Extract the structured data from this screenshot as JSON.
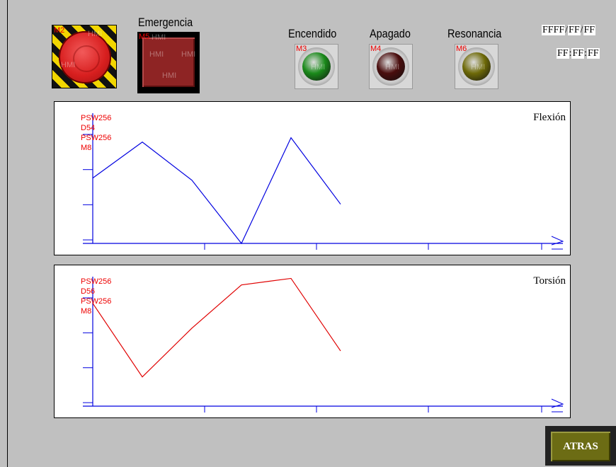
{
  "estop": {
    "tag": "M2"
  },
  "emergency": {
    "label": "Emergencia",
    "tag": "M5"
  },
  "lamps": [
    {
      "label": "Encendido",
      "tag": "M3",
      "color": "#1a8a1a"
    },
    {
      "label": "Apagado",
      "tag": "M4",
      "color": "#4a0d0d"
    },
    {
      "label": "Resonancia",
      "tag": "M6",
      "color": "#6e6a08"
    }
  ],
  "datetime": {
    "y": "FFFF",
    "m": "FF",
    "d": "FF",
    "sep_date": "/",
    "hh": "FF",
    "mm": "FF",
    "ss": "FF",
    "sep_time": ":"
  },
  "watermark": "HMI",
  "charts": {
    "flexion": {
      "title": "Flexión",
      "tags": [
        "PSW256",
        "D54",
        "PSW256",
        "M8"
      ],
      "color": "#0000e0",
      "values": [
        0.6,
        0.93,
        0.58,
        0.0,
        0.97,
        0.36
      ]
    },
    "torsion": {
      "title": "Torsión",
      "tags": [
        "PSW256",
        "D56",
        "PSW256",
        "M8"
      ],
      "color": "#e00000",
      "values": [
        0.95,
        0.27,
        0.72,
        1.12,
        1.18,
        0.51
      ]
    }
  },
  "atras": {
    "label": "ATRAS"
  }
}
